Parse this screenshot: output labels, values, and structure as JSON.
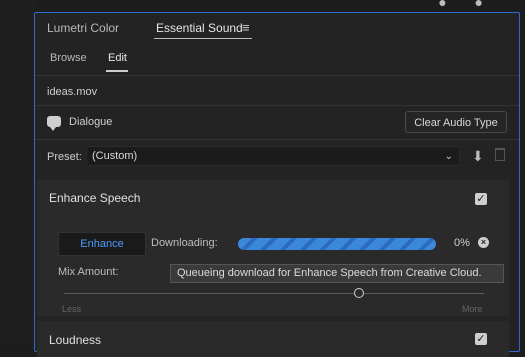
{
  "panel_tabs": {
    "lumetri": "Lumetri Color",
    "essential_sound": "Essential Sound",
    "menu_icon": "≡"
  },
  "subtabs": {
    "browse": "Browse",
    "edit": "Edit"
  },
  "clip": {
    "filename": "ideas.mov"
  },
  "type": {
    "label": "Dialogue",
    "clear_button": "Clear Audio Type"
  },
  "preset": {
    "label": "Preset:",
    "value": "(Custom)"
  },
  "enhance_speech": {
    "title": "Enhance Speech",
    "enhanced_checked": true,
    "enhance_button": "Enhance",
    "downloading_label": "Downloading:",
    "progress_percent": "0%",
    "mix_label": "Mix Amount:",
    "tooltip": "Queueing download for Enhance Speech from Creative Cloud.",
    "less_label": "Less",
    "more_label": "More",
    "slider_value": 0.7
  },
  "loudness": {
    "title": "Loudness",
    "checked": true
  },
  "colors": {
    "accent": "#2e6bd0",
    "enhance_text": "#4a9eff",
    "progress": "#3b87d9"
  }
}
